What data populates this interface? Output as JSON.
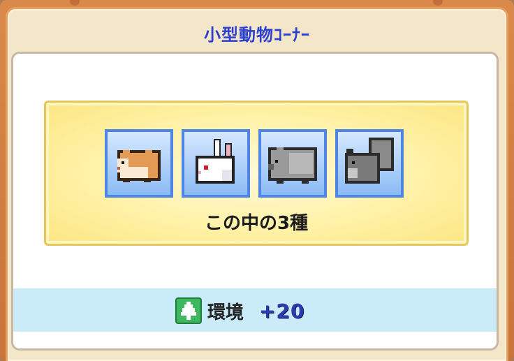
{
  "window": {
    "title": "小型動物ｺｰﾅｰ"
  },
  "group": {
    "caption": "この中の3種",
    "animals": [
      {
        "name": "hamster-icon"
      },
      {
        "name": "rabbit-icon"
      },
      {
        "name": "gray-animal-icon"
      },
      {
        "name": "gray-squirrel-icon"
      }
    ]
  },
  "effect": {
    "icon": "tree-icon",
    "label": "環境",
    "value": "+20"
  },
  "colors": {
    "title": "#2a3fd0",
    "tile_border": "#4f86e6",
    "bar_bg": "#c9ecf8",
    "group_border": "#e6c659"
  }
}
